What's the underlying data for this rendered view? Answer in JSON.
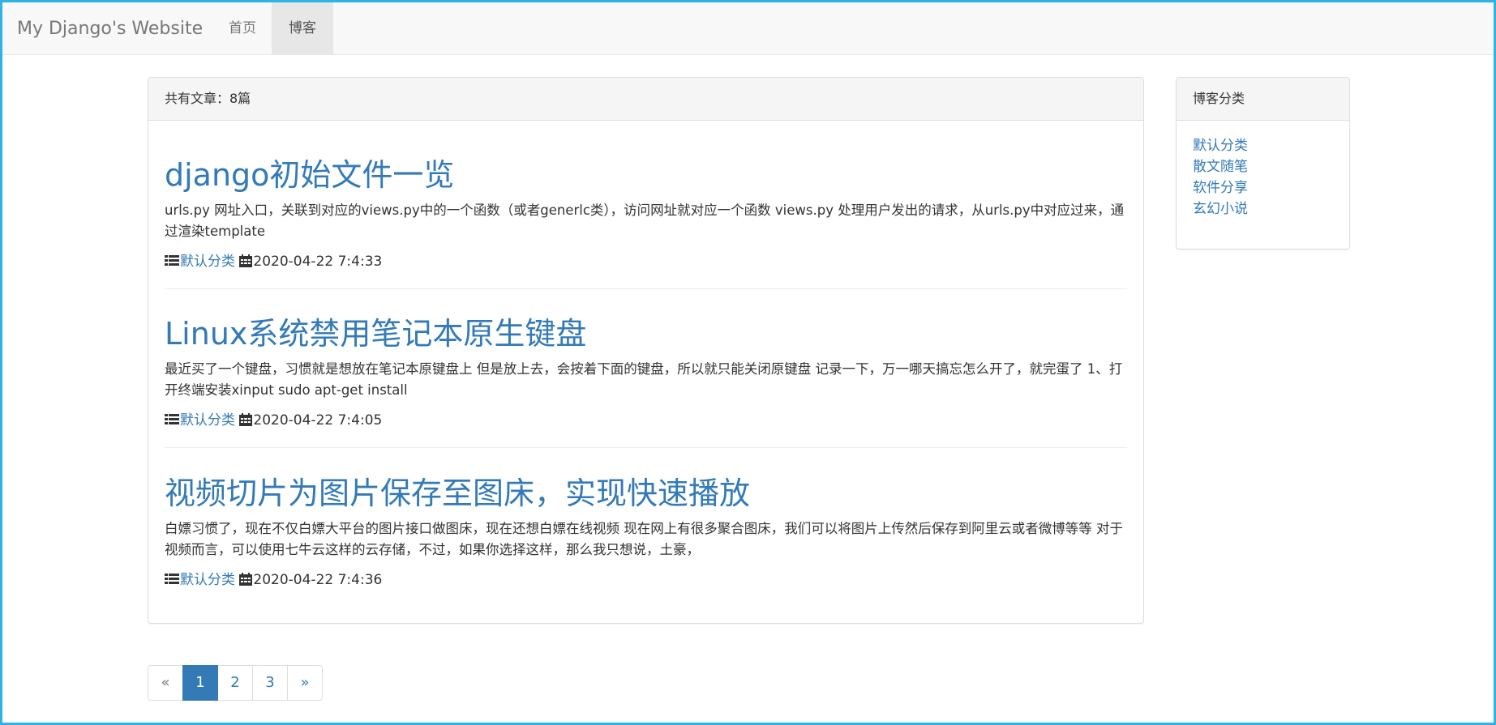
{
  "navbar": {
    "brand": "My Django's Website",
    "items": [
      {
        "label": "首页",
        "active": false
      },
      {
        "label": "博客",
        "active": true
      }
    ]
  },
  "main": {
    "heading": "共有文章：8篇",
    "articles": [
      {
        "title": "django初始文件一览",
        "summary": "urls.py 网址入口，关联到对应的views.py中的一个函数（或者generlc类），访问网址就对应一个函数 views.py 处理用户发出的请求，从urls.py中对应过来，通过渲染template",
        "category": "默认分类",
        "datetime": "2020-04-22 7:4:33"
      },
      {
        "title": "Linux系统禁用笔记本原生键盘",
        "summary": "最近买了一个键盘，习惯就是想放在笔记本原键盘上 但是放上去，会按着下面的键盘，所以就只能关闭原键盘 记录一下，万一哪天搞忘怎么开了，就完蛋了 1、打开终端安装xinput sudo apt-get install",
        "category": "默认分类",
        "datetime": "2020-04-22 7:4:05"
      },
      {
        "title": "视频切片为图片保存至图床，实现快速播放",
        "summary": "白嫖习惯了，现在不仅白嫖大平台的图片接口做图床，现在还想白嫖在线视频 现在网上有很多聚合图床，我们可以将图片上传然后保存到阿里云或者微博等等 对于视频而言，可以使用七牛云这样的云存储，不过，如果你选择这样，那么我只想说，土豪，",
        "category": "默认分类",
        "datetime": "2020-04-22 7:4:36"
      }
    ]
  },
  "sidebar": {
    "heading": "博客分类",
    "categories": [
      "默认分类",
      "散文随笔",
      "软件分享",
      "玄幻小说"
    ]
  },
  "pagination": {
    "prev": "«",
    "pages": [
      "1",
      "2",
      "3"
    ],
    "current": "1",
    "next": "»"
  },
  "colors": {
    "link": "#337ab7",
    "active_page": "#337ab7",
    "window_border": "#2fb3e6"
  },
  "icons": {
    "category": "list-icon",
    "date": "calendar-icon"
  }
}
